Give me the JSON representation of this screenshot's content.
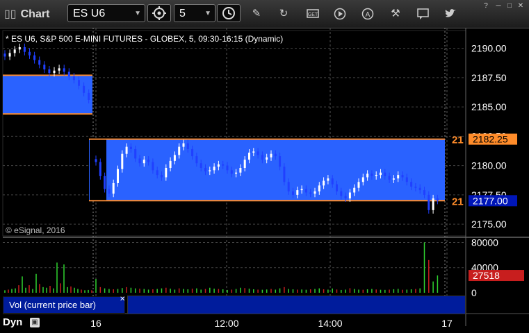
{
  "window": {
    "title": "Chart",
    "symbol": "ES U6",
    "interval": "5",
    "toolbar_tools": [
      "pencil-icon",
      "cycle-icon",
      "get-icon",
      "play-icon",
      "alert-icon",
      "tools-icon",
      "comment-icon",
      "twitter-icon"
    ]
  },
  "legend": {
    "text": "* ES U6, S&P 500 E-MINI FUTURES - GLOBEX, 5, 09:30-16:15 (Dynamic)"
  },
  "copyright": "© eSignal, 2016",
  "colors": {
    "up": "#ffffff",
    "down": "#2040ff",
    "box_fill": "#2a62ff",
    "box_line": "#ff8c2a",
    "grid": "#444444",
    "vol_up": "#2fd22f",
    "vol_down": "#c81e1e",
    "panel_blue": "#001c9c"
  },
  "price_axis": {
    "labels": [
      "2190.00",
      "2187.50",
      "2185.00",
      "2182.50",
      "2180.00",
      "2177.50",
      "2175.00"
    ],
    "values": [
      2190.0,
      2187.5,
      2185.0,
      2182.5,
      2180.0,
      2177.5,
      2175.0
    ],
    "min": 2174.0,
    "max": 2191.4
  },
  "price_tags": [
    {
      "text": "2182.25",
      "price": 2182.25,
      "bg": "#ff8c2a",
      "fg": "#000000",
      "left_text": "21"
    },
    {
      "text": "2177.00",
      "price": 2177.0,
      "bg": "#0016b8",
      "fg": "#ffffff",
      "left_text": "21"
    }
  ],
  "volume_axis": {
    "labels": [
      "80000",
      "40000",
      "0"
    ],
    "values": [
      80000,
      40000,
      0
    ],
    "max": 86000
  },
  "volume_tag": {
    "text": "27518",
    "value": 27518,
    "bg": "#c81e1e",
    "fg": "#ffffff"
  },
  "vol_label": "Vol (current price bar)",
  "dyn_label": "Dyn",
  "time_axis": {
    "labels": [
      "16",
      "12:00",
      "14:00",
      "17"
    ]
  },
  "chart_data": {
    "type": "candlestick",
    "session_breaks": [
      "16",
      "17"
    ],
    "range_boxes": [
      {
        "day": "previous",
        "high": 2187.7,
        "low": 2184.4
      },
      {
        "day": "current",
        "high": 2182.25,
        "low": 2177.0
      }
    ],
    "prev_day_closes": [
      2189.3,
      2189.6,
      2189.9,
      2190.1,
      2189.7,
      2189.4,
      2189.0,
      2188.6,
      2188.2,
      2187.9,
      2188.1,
      2188.3,
      2188.0,
      2187.6,
      2187.3,
      2186.8,
      2186.2,
      2185.6
    ],
    "current_day_closes": [
      2180.3,
      2179.1,
      2178.0,
      2177.6,
      2178.5,
      2179.7,
      2181.0,
      2181.6,
      2181.4,
      2180.6,
      2180.2,
      2180.5,
      2180.3,
      2179.6,
      2179.2,
      2179.0,
      2179.8,
      2180.4,
      2180.9,
      2181.6,
      2181.9,
      2181.4,
      2180.8,
      2180.2,
      2179.8,
      2179.5,
      2179.6,
      2179.9,
      2180.1,
      2180.0,
      2179.6,
      2179.3,
      2179.4,
      2179.8,
      2180.5,
      2181.1,
      2181.2,
      2180.9,
      2180.5,
      2180.7,
      2181.0,
      2180.8,
      2179.9,
      2178.6,
      2177.8,
      2177.5,
      2177.9,
      2178.0,
      2177.7,
      2177.6,
      2177.8,
      2178.3,
      2178.7,
      2178.9,
      2178.4,
      2177.8,
      2177.4,
      2177.2,
      2177.7,
      2178.1,
      2178.6,
      2179.0,
      2179.3,
      2179.1,
      2179.2,
      2179.4,
      2179.1,
      2178.8,
      2178.9,
      2179.2,
      2179.0,
      2178.6,
      2178.2,
      2178.1,
      2177.9,
      2177.5,
      2176.2,
      2177.2,
      2177.0
    ],
    "current_day_volume": [
      22000,
      9000,
      7000,
      6000,
      5500,
      6000,
      7500,
      9000,
      8000,
      7000,
      6500,
      6000,
      5000,
      5500,
      6000,
      7000,
      8000,
      6500,
      5000,
      7000,
      6000,
      5500,
      6500,
      7000,
      5000,
      6000,
      8000,
      6500,
      6000,
      5500,
      4500,
      5000,
      6000,
      8000,
      7500,
      6500,
      5500,
      5000,
      4800,
      5200,
      6000,
      5000,
      7000,
      9000,
      6000,
      5500,
      5000,
      5200,
      4800,
      5500,
      6000,
      7000,
      5500,
      5000,
      6800,
      5200,
      4500,
      5000,
      7200,
      6000,
      5000,
      4800,
      5500,
      6000,
      5200,
      4800,
      4600,
      5000,
      5600,
      6200,
      4800,
      5000,
      5500,
      6000,
      7000,
      80000,
      52000,
      18000,
      27518
    ],
    "prev_day_volume": [
      4000,
      5000,
      6000,
      7000,
      12000,
      26000,
      8000,
      12000,
      6000,
      30000,
      14000,
      9000,
      8000,
      11000,
      7000,
      48000,
      15000,
      45000,
      9000,
      10000,
      8000,
      6000,
      5000,
      4000,
      4500,
      4000
    ],
    "x_labels": [
      "16",
      "12:00",
      "14:00",
      "17"
    ],
    "price_ylim": [
      2174.0,
      2191.4
    ],
    "volume_ylim": [
      0,
      86000
    ]
  }
}
